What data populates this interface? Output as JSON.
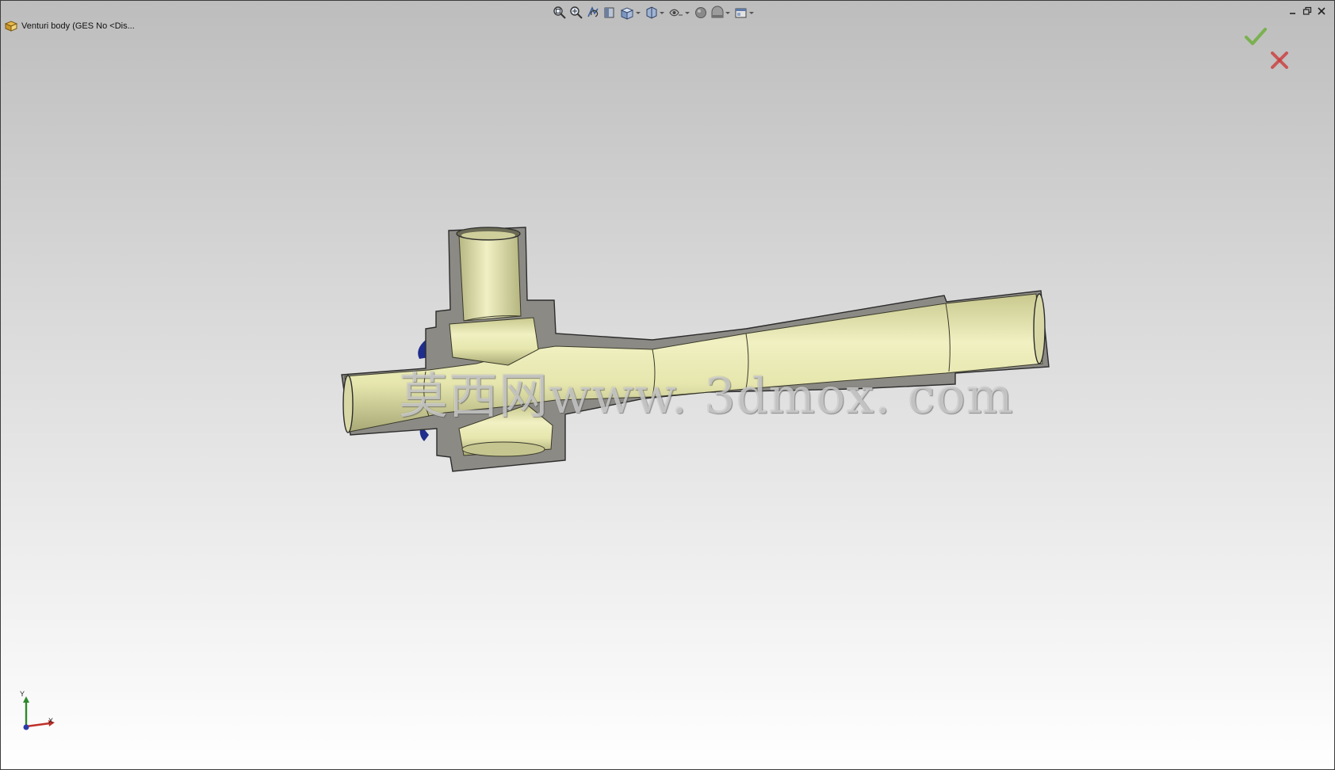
{
  "document": {
    "title": "Venturi body  (GES No <Dis..."
  },
  "heads_up_toolbar": {
    "icons": [
      "zoom-to-fit-icon",
      "zoom-to-area-icon",
      "previous-view-icon",
      "section-view-icon",
      "view-orientation-icon",
      "display-style-icon",
      "hide-show-items-icon",
      "edit-appearance-icon",
      "apply-scene-icon",
      "view-settings-icon"
    ]
  },
  "confirmation_corner": {
    "ok_color": "#6fae3c",
    "cancel_color": "#cc3b3b"
  },
  "model": {
    "name": "Venturi body",
    "view": "section",
    "face_color": "#e8e8b0",
    "section_color": "#8c8a85"
  },
  "watermark": {
    "text": "莫西网www. 3dmox. com"
  },
  "triad": {
    "x_label": "X",
    "y_label": "Y",
    "x_color": "#c0302a",
    "y_color": "#2c8a2c",
    "z_color": "#2a3aa8"
  }
}
